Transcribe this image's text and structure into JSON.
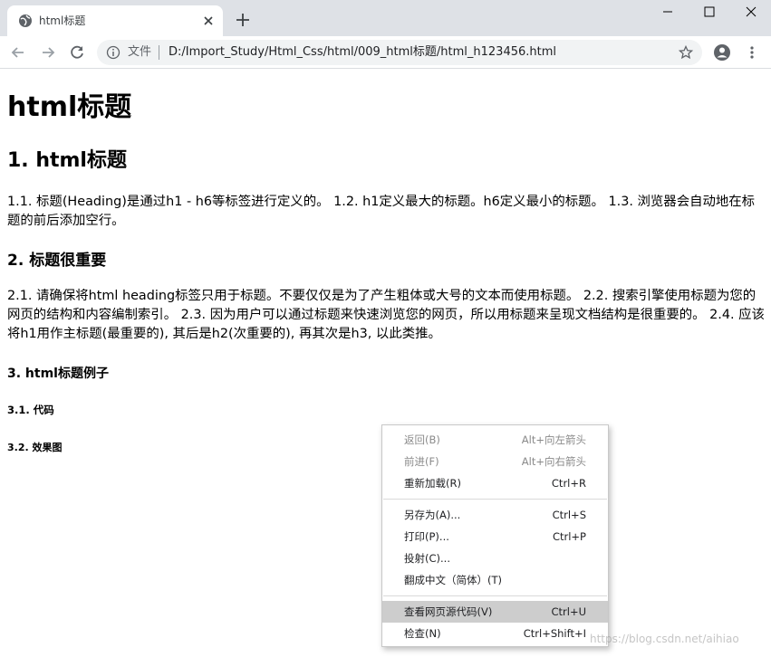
{
  "window": {
    "tab_title": "html标题",
    "new_tab_label": "+"
  },
  "toolbar": {
    "omnibox_label": "文件",
    "url": "D:/Import_Study/Html_Css/html/009_html标题/html_h123456.html"
  },
  "page": {
    "h1": "html标题",
    "h2": "1. html标题",
    "p1": "1.1. 标题(Heading)是通过h1 - h6等标签进行定义的。 1.2. h1定义最大的标题。h6定义最小的标题。 1.3. 浏览器会自动地在标题的前后添加空行。",
    "h3": "2. 标题很重要",
    "p2": "2.1. 请确保将html heading标签只用于标题。不要仅仅是为了产生粗体或大号的文本而使用标题。 2.2. 搜索引擎使用标题为您的网页的结构和内容编制索引。 2.3. 因为用户可以通过标题来快速浏览您的网页，所以用标题来呈现文档结构是很重要的。 2.4. 应该将h1用作主标题(最重要的), 其后是h2(次重要的), 再其次是h3, 以此类推。",
    "h4": "3. html标题例子",
    "h5": "3.1. 代码",
    "h6": "3.2. 效果图"
  },
  "context_menu": {
    "items": [
      {
        "label": "返回(B)",
        "shortcut": "Alt+向左箭头"
      },
      {
        "label": "前进(F)",
        "shortcut": "Alt+向右箭头"
      },
      {
        "label": "重新加载(R)",
        "shortcut": "Ctrl+R"
      },
      {
        "label": "另存为(A)...",
        "shortcut": "Ctrl+S"
      },
      {
        "label": "打印(P)...",
        "shortcut": "Ctrl+P"
      },
      {
        "label": "投射(C)...",
        "shortcut": ""
      },
      {
        "label": "翻成中文（简体）(T)",
        "shortcut": ""
      },
      {
        "label": "查看网页源代码(V)",
        "shortcut": "Ctrl+U"
      },
      {
        "label": "检查(N)",
        "shortcut": "Ctrl+Shift+I"
      }
    ]
  },
  "watermark": "https://blog.csdn.net/aihiao",
  "colors": {
    "tabstrip_bg": "#dee1e6",
    "omnibox_bg": "#f1f3f4",
    "menu_highlight": "#cdcdcd",
    "icon_gray": "#5f6368"
  },
  "icons": [
    "globe-icon",
    "close-icon",
    "plus-icon",
    "minimize-icon",
    "maximize-icon",
    "window-close-icon",
    "back-arrow-icon",
    "forward-arrow-icon",
    "reload-icon",
    "info-icon",
    "star-icon",
    "profile-icon",
    "menu-dots-icon"
  ]
}
